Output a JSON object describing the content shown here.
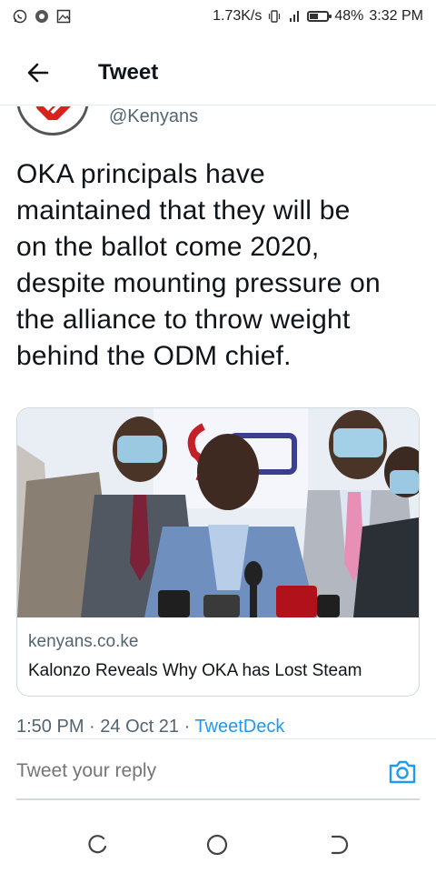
{
  "status_bar": {
    "speed": "1.73K/s",
    "battery": "48%",
    "time": "3:32 PM",
    "battery_level": 0.48,
    "left_icons": [
      "whatsapp-icon",
      "chrome-icon",
      "gallery-icon"
    ],
    "right_icons": [
      "vibrate-icon",
      "signal-icon",
      "battery-icon"
    ]
  },
  "header": {
    "title": "Tweet",
    "back_icon": "arrow-left-icon"
  },
  "author": {
    "handle": "@Kenyans",
    "avatar": "kenyans-logo-avatar"
  },
  "tweet": {
    "lines": [
      "OKA principals have",
      "maintained that they will be",
      "on the ballot come 2020,",
      "despite mounting pressure on",
      "the alliance to throw weight",
      "behind the ODM chief."
    ]
  },
  "card": {
    "image": "press-conference-photo",
    "domain": "kenyans.co.ke",
    "title": "Kalonzo Reveals Why OKA has Lost Steam"
  },
  "meta": {
    "time": "1:50 PM",
    "sep1": "·",
    "date": "24 Oct 21",
    "sep2": "·",
    "source": "TweetDeck"
  },
  "reply": {
    "placeholder": "Tweet your reply",
    "camera_icon": "camera-icon"
  },
  "colors": {
    "accent": "#1d9bf0",
    "text": "#0f1419",
    "secondary": "#536471",
    "brand_red": "#d7231b"
  }
}
